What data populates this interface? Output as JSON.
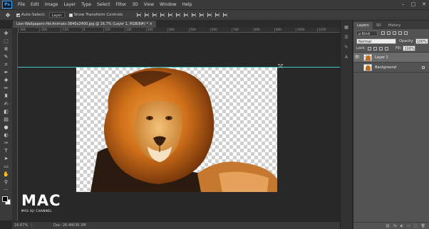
{
  "menubar": {
    "logo": "Ps",
    "items": [
      "File",
      "Edit",
      "Image",
      "Layer",
      "Type",
      "Select",
      "Filter",
      "3D",
      "View",
      "Window",
      "Help"
    ],
    "window_controls": [
      "–",
      "□",
      "✕"
    ]
  },
  "optionsbar": {
    "auto_select_label": "Auto-Select:",
    "auto_select_value": "Layer",
    "show_transform_label": "Show Transform Controls"
  },
  "document": {
    "tab_title": "Lion-Wallpapers-Hd-Animals-3840x2400.jpg @ 16.7% (Layer 1, RGB/8#) *",
    "tab_close": "×"
  },
  "ruler": {
    "ticks": [
      "-300",
      "-200",
      "-100",
      "0",
      "100",
      "200",
      "300",
      "400",
      "500",
      "600",
      "700",
      "800",
      "900",
      "1000",
      "1100"
    ]
  },
  "statusbar": {
    "zoom": "16.67%",
    "doc_info": "Doc: 26.4M/36.3M"
  },
  "watermark": {
    "logo_text": "MAC",
    "sub_text": "MAS AJI CHANNEL"
  },
  "layers_panel": {
    "tabs": [
      "Layers",
      "3D",
      "History"
    ],
    "kind_label": "ρ Kind",
    "blend_mode": "Normal",
    "opacity_label": "Opacity:",
    "opacity_value": "100%",
    "lock_label": "Lock:",
    "fill_label": "Fill:",
    "fill_value": "100%",
    "layers": [
      {
        "name": "Layer 1",
        "selected": true
      },
      {
        "name": "Background",
        "selected": false
      }
    ],
    "bottom_icons": [
      "fx",
      "◐",
      "▭",
      "□",
      "🗑"
    ]
  },
  "colors": {
    "accent": "#31a8ff",
    "guide": "#3fc7c7",
    "lion_orange": "#c86a16"
  }
}
